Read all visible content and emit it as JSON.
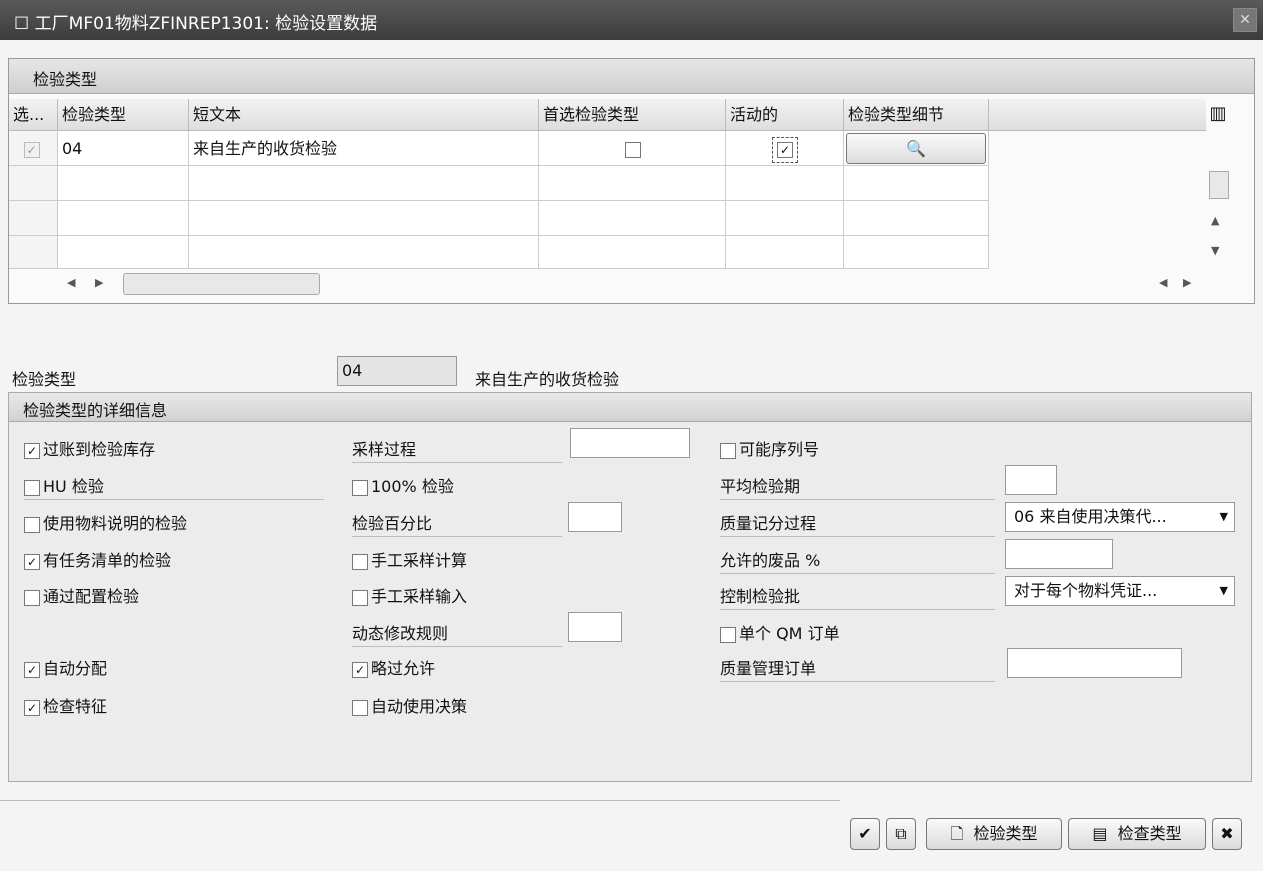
{
  "window": {
    "title": "工厂MF01物料ZFINREP1301: 检验设置数据",
    "close_icon": "close-icon"
  },
  "table": {
    "title": "检验类型",
    "columns": [
      "选...",
      "检验类型",
      "短文本",
      "首选检验类型",
      "活动的",
      "检验类型细节"
    ],
    "rows": [
      {
        "selected": true,
        "type": "04",
        "text": "来自生产的收货检验",
        "preferred": false,
        "active": true
      }
    ]
  },
  "summary": {
    "label": "检验类型",
    "value": "04",
    "description": "来自生产的收货检验"
  },
  "details": {
    "title": "检验类型的详细信息",
    "col1": [
      {
        "label": "过账到检验库存",
        "checked": true
      },
      {
        "label": "HU 检验",
        "checked": false
      },
      {
        "label": "使用物料说明的检验",
        "checked": false
      },
      {
        "label": "有任务清单的检验",
        "checked": true
      },
      {
        "label": "通过配置检验",
        "checked": false
      },
      {
        "label": "自动分配",
        "checked": true
      },
      {
        "label": "检查特征",
        "checked": true
      }
    ],
    "col2": {
      "sampling_procedure": "采样过程",
      "check_100": {
        "label": "100% 检验",
        "checked": false
      },
      "inspection_percent": "检验百分比",
      "manual_sample_calc": {
        "label": "手工采样计算",
        "checked": false
      },
      "manual_sample_entry": {
        "label": "手工采样输入",
        "checked": false
      },
      "dynamic_rule": "动态修改规则",
      "skip_allowed": {
        "label": "略过允许",
        "checked": true
      },
      "auto_usage_decision": {
        "label": "自动使用决策",
        "checked": false
      }
    },
    "col3": {
      "serial_numbers": {
        "label": "可能序列号",
        "checked": false
      },
      "avg_inspection_duration": "平均检验期",
      "quality_score_procedure": {
        "label": "质量记分过程",
        "value": "06 来自使用决策代..."
      },
      "allowed_scrap": "允许的废品 %",
      "control_insp_lot": {
        "label": "控制检验批",
        "value": "对于每个物料凭证..."
      },
      "single_qm_order": {
        "label": "单个 QM 订单",
        "checked": false
      },
      "qm_order": "质量管理订单"
    }
  },
  "footer": {
    "btn_new": "检验类型",
    "btn_check": "检查类型"
  }
}
